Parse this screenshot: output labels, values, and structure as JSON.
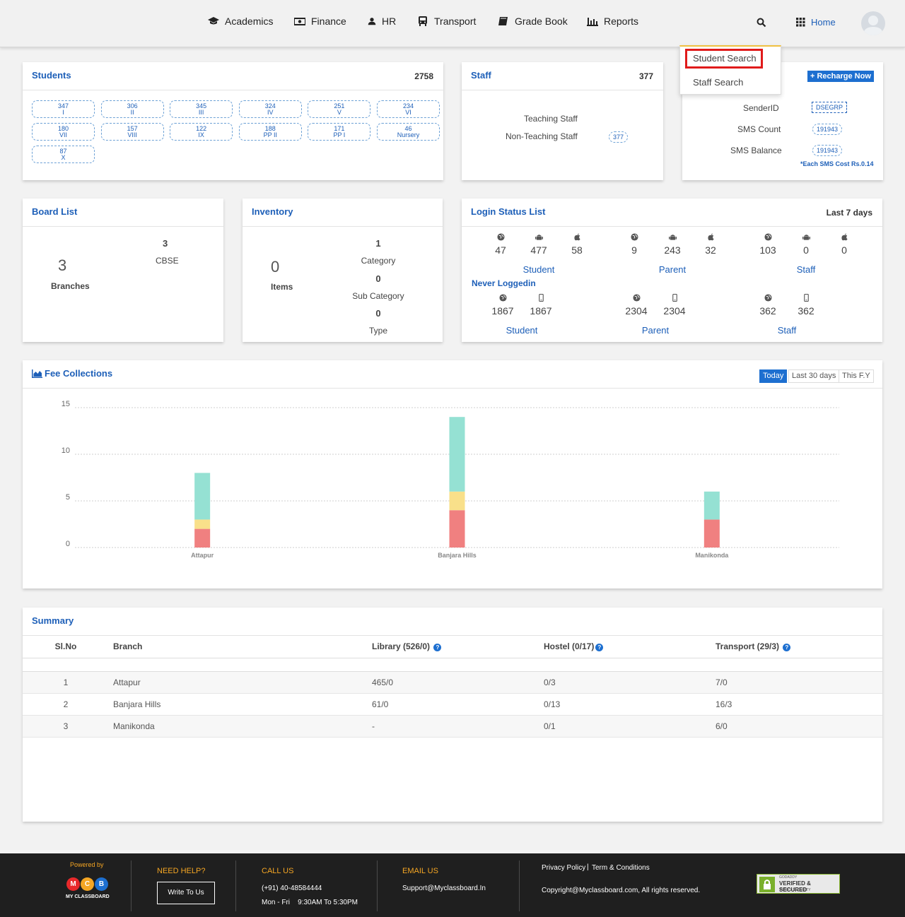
{
  "nav": {
    "items": [
      {
        "label": "Academics",
        "icon": "graduation-cap-icon"
      },
      {
        "label": "Finance",
        "icon": "money-icon"
      },
      {
        "label": "HR",
        "icon": "user-icon"
      },
      {
        "label": "Transport",
        "icon": "bus-icon"
      },
      {
        "label": "Grade Book",
        "icon": "book-icon"
      },
      {
        "label": "Reports",
        "icon": "bar-chart-icon"
      }
    ],
    "home_label": "Home"
  },
  "dropdown": {
    "items": [
      "Student Search",
      "Staff Search"
    ]
  },
  "students": {
    "title": "Students",
    "count": "2758",
    "classes": [
      {
        "count": "347",
        "name": "I"
      },
      {
        "count": "306",
        "name": "II"
      },
      {
        "count": "345",
        "name": "III"
      },
      {
        "count": "324",
        "name": "IV"
      },
      {
        "count": "251",
        "name": "V"
      },
      {
        "count": "234",
        "name": "VI"
      },
      {
        "count": "180",
        "name": "VII"
      },
      {
        "count": "157",
        "name": "VIII"
      },
      {
        "count": "122",
        "name": "IX"
      },
      {
        "count": "188",
        "name": "PP II"
      },
      {
        "count": "171",
        "name": "PP I"
      },
      {
        "count": "46",
        "name": "Nursery"
      },
      {
        "count": "87",
        "name": "X"
      }
    ]
  },
  "staff": {
    "title": "Staff",
    "count": "377",
    "teaching_label": "Teaching Staff",
    "non_teaching_label": "Non-Teaching Staff",
    "non_teaching_count": "377"
  },
  "sms": {
    "recharge_label": "+ Recharge Now",
    "sender_label": "SenderID",
    "sender_value": "DSEGRP",
    "count_label": "SMS Count",
    "count_value": "191943",
    "balance_label": "SMS Balance",
    "balance_value": "191943",
    "cost_note": "*Each SMS Cost Rs.0.14"
  },
  "board": {
    "title": "Board List",
    "branches_count": "3",
    "branches_label": "Branches",
    "cbse_count": "3",
    "cbse_label": "CBSE"
  },
  "inventory": {
    "title": "Inventory",
    "items_count": "0",
    "items_label": "Items",
    "category_count": "1",
    "category_label": "Category",
    "subcategory_count": "0",
    "subcategory_label": "Sub Category",
    "type_count": "0",
    "type_label": "Type"
  },
  "login": {
    "title": "Login Status List",
    "period": "Last 7 days",
    "groups": [
      {
        "label": "Student",
        "web": "47",
        "android": "477",
        "ios": "58"
      },
      {
        "label": "Parent",
        "web": "9",
        "android": "243",
        "ios": "32"
      },
      {
        "label": "Staff",
        "web": "103",
        "android": "0",
        "ios": "0"
      }
    ],
    "never_title": "Never Loggedin",
    "never_groups": [
      {
        "label": "Student",
        "web": "1867",
        "mobile": "1867"
      },
      {
        "label": "Parent",
        "web": "2304",
        "mobile": "2304"
      },
      {
        "label": "Staff",
        "web": "362",
        "mobile": "362"
      }
    ]
  },
  "fees": {
    "title": "Fee Collections",
    "tabs": [
      "Today",
      "Last 30 days",
      "This F.Y"
    ],
    "active_tab": "Today"
  },
  "chart_data": {
    "type": "bar",
    "stacked": true,
    "categories": [
      "Attapur",
      "Banjara Hills",
      "Manikonda"
    ],
    "series": [
      {
        "color": "#f08080",
        "values": [
          2,
          4,
          3
        ]
      },
      {
        "color": "#f9e08a",
        "values": [
          1,
          2,
          0
        ]
      },
      {
        "color": "#95e1d3",
        "values": [
          5,
          8,
          3
        ]
      }
    ],
    "y_ticks": [
      "0",
      "5",
      "10",
      "15"
    ],
    "ylim": [
      0,
      15
    ],
    "grid": true
  },
  "summary": {
    "title": "Summary",
    "columns": [
      "Sl.No",
      "Branch",
      "Library (526/0)",
      "Hostel (0/17)",
      "Transport (29/3)"
    ],
    "rows": [
      [
        "1",
        "Attapur",
        "465/0",
        "0/3",
        "7/0"
      ],
      [
        "2",
        "Banjara Hills",
        "61/0",
        "0/13",
        "16/3"
      ],
      [
        "3",
        "Manikonda",
        "-",
        "0/1",
        "6/0"
      ]
    ]
  },
  "footer": {
    "powered_by": "Powered by",
    "brand": "MY CLASSBOARD",
    "logo_letters": [
      "M",
      "C",
      "B"
    ],
    "help_head": "NEED HELP?",
    "write_label": "Write To Us",
    "call_head": "CALL US",
    "phone": "(+91) 40-48584444",
    "hours": "Mon - Fri    9:30AM To 5:30PM",
    "email_head": "EMAIL US",
    "email": "Support@Myclassboard.In",
    "privacy": "Privacy Policy",
    "terms": "Term & Conditions",
    "copyright": "Copyright@Myclassboard.com, All rights reserved.",
    "seal_top": "GODADDY",
    "seal_main": "VERIFIED & SECURED",
    "seal_bottom": "VERIFY SECURITY"
  }
}
